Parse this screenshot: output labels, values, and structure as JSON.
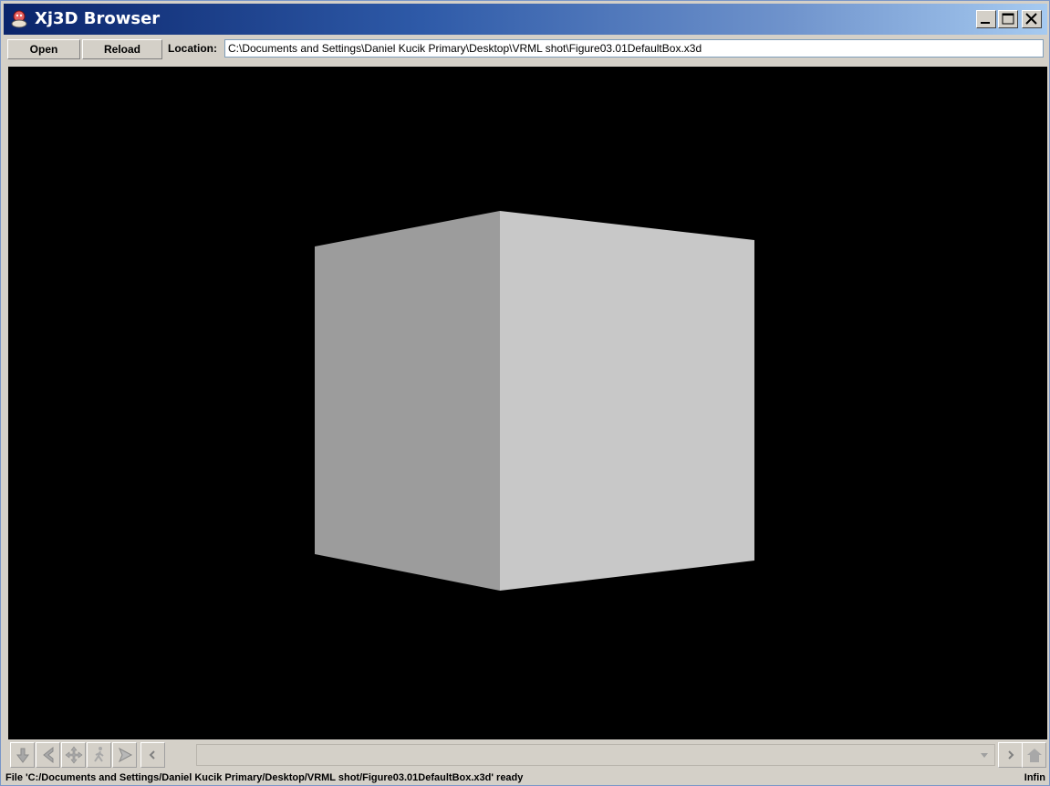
{
  "window": {
    "title": "Xj3D Browser"
  },
  "toolbar": {
    "open_label": "Open",
    "reload_label": "Reload",
    "location_label": "Location:",
    "location_value": "C:\\Documents and Settings\\Daniel Kucik Primary\\Desktop\\VRML shot\\Figure03.01DefaultBox.x3d"
  },
  "viewport": {
    "background": "#000000",
    "box_left_face_color": "#9c9c9c",
    "box_right_face_color": "#c8c8c8"
  },
  "navbar": {
    "icons": [
      "pan-icon",
      "back-icon",
      "examine-icon",
      "walk-icon",
      "fly-icon",
      "prev-viewpoint-icon",
      "dropdown-arrow-icon",
      "next-viewpoint-icon",
      "home-icon"
    ]
  },
  "status": {
    "message": "File 'C:/Documents and Settings/Daniel Kucik Primary/Desktop/VRML shot/Figure03.01DefaultBox.x3d' ready",
    "right_text": "Infin"
  }
}
